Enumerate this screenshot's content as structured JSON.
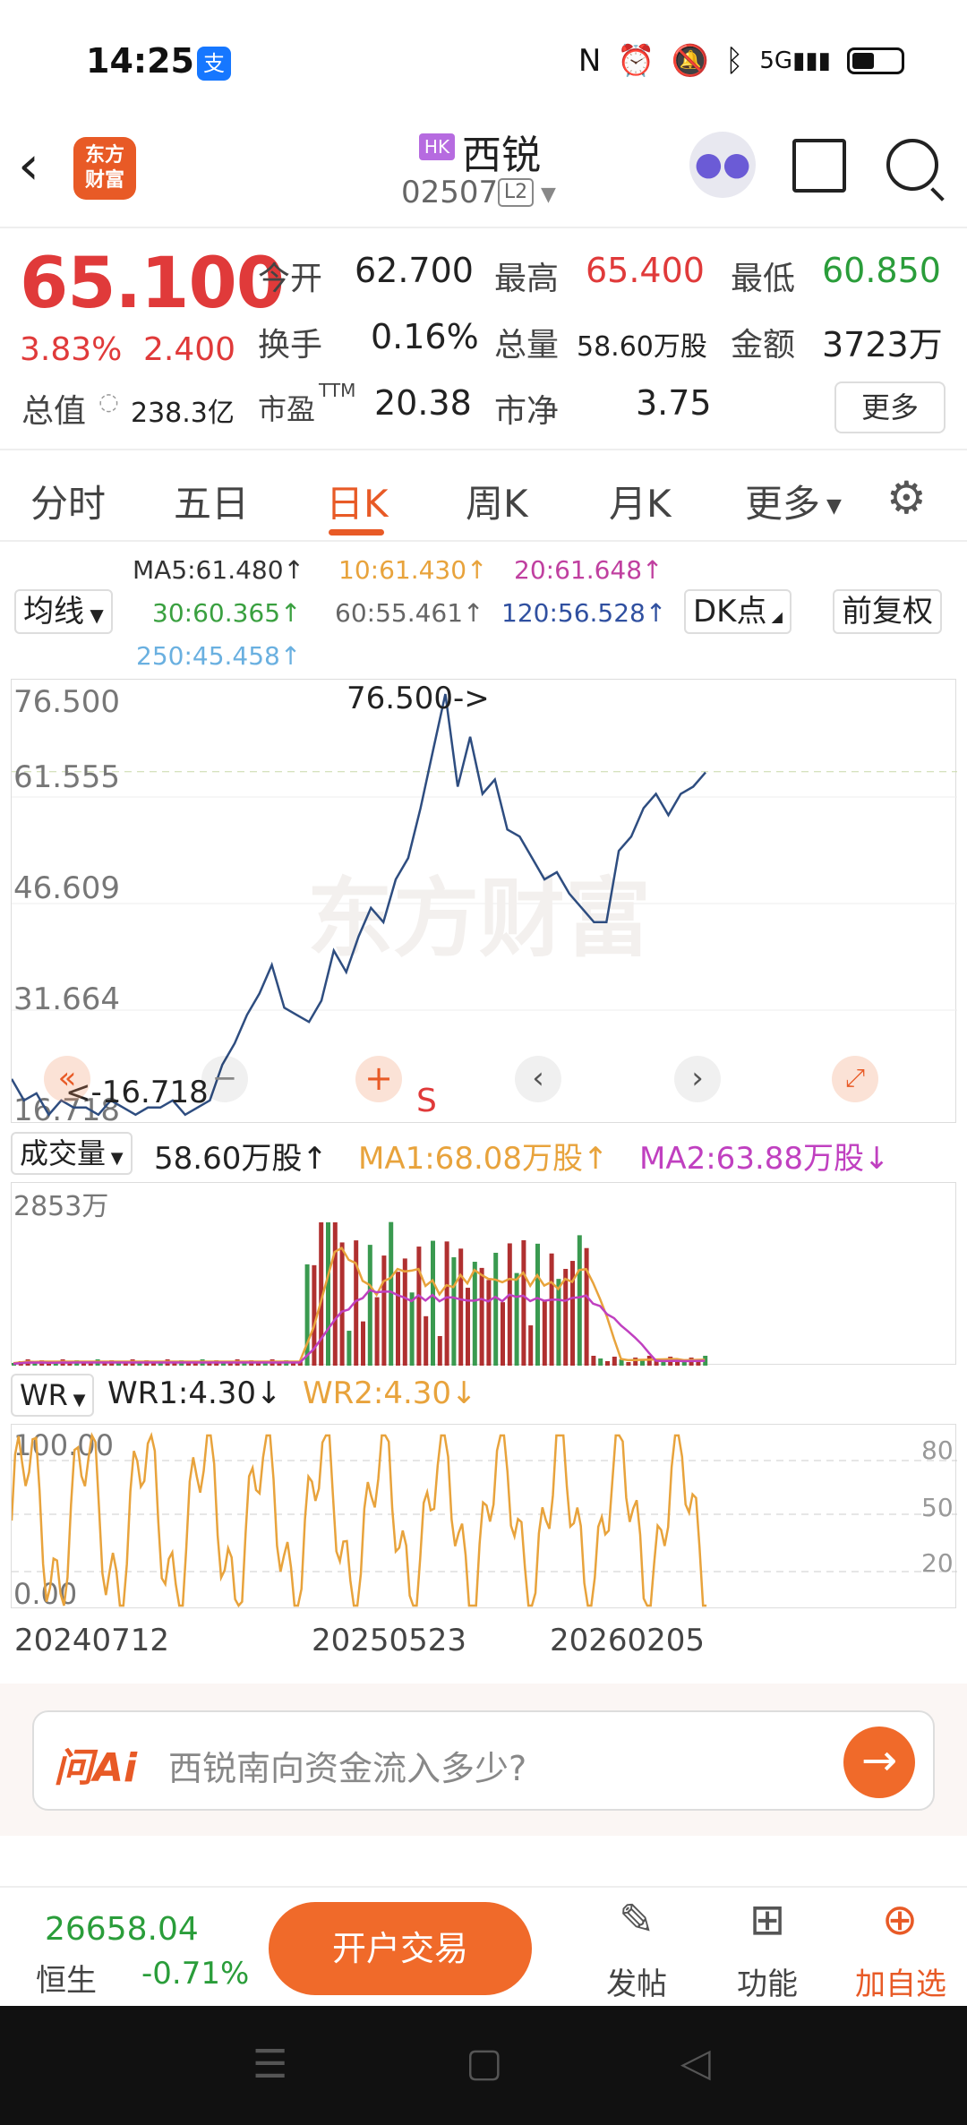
{
  "status": {
    "time": "14:25",
    "alipay": "支",
    "icons": [
      "nfc-icon",
      "alarm-icon",
      "mute-icon",
      "bluetooth-icon",
      "signal-5g-icon"
    ],
    "net": "5G"
  },
  "header": {
    "logo": "东方财富",
    "market": "HK",
    "name": "西锐",
    "code": "02507",
    "level": "L2"
  },
  "quote": {
    "price": "65.100",
    "pct": "3.83%",
    "change": "2.400",
    "open_label": "今开",
    "open": "62.700",
    "high_label": "最高",
    "high": "65.400",
    "low_label": "最低",
    "low": "60.850",
    "turnover_label": "换手",
    "turnover": "0.16%",
    "vol_label": "总量",
    "vol": "58.60万股",
    "amount_label": "金额",
    "amount": "3723万",
    "mcap_label": "总值",
    "mcap": "238.3亿",
    "pe_label": "市盈",
    "pe_sup": "TTM",
    "pe": "20.38",
    "pb_label": "市净",
    "pb": "3.75",
    "more": "更多"
  },
  "tabs": [
    "分时",
    "五日",
    "日K",
    "周K",
    "月K",
    "更多"
  ],
  "active_tab": "日K",
  "ma": {
    "selector": "均线",
    "ma5": "MA5:61.480↑",
    "ma10": "10:61.430↑",
    "ma20": "20:61.648↑",
    "ma30": "30:60.365↑",
    "ma60": "60:55.461↑",
    "ma120": "120:56.528↑",
    "ma250": "250:45.458↑",
    "dk": "DK点",
    "fq": "前复权",
    "colors": {
      "ma5": "#333333",
      "ma10": "#e8a33c",
      "ma20": "#c040a0",
      "ma30": "#3aa040",
      "ma60": "#666666",
      "ma120": "#3050a0",
      "ma250": "#6ab0e0"
    }
  },
  "price_chart": {
    "yticks": [
      "76.500",
      "61.555",
      "46.609",
      "31.664",
      "16.718"
    ],
    "max_marker": "76.500->",
    "min_marker": "<-16.718",
    "signal": "S",
    "watermark": "东方财富"
  },
  "volume": {
    "selector": "成交量",
    "value": "58.60万股↑",
    "ma1": "MA1:68.08万股↑",
    "ma2": "MA2:63.88万股↓",
    "ytick": "2853万"
  },
  "wr": {
    "selector": "WR",
    "wr1": "WR1:4.30↓",
    "wr2": "WR2:4.30↓",
    "yticks_left": [
      "100.00",
      "0.00"
    ],
    "yticks_right": [
      "80",
      "50",
      "20"
    ]
  },
  "dates": [
    "20240712",
    "20250523",
    "20260205"
  ],
  "chart_data": {
    "type": "line",
    "title": "",
    "xlabel": "",
    "ylabel": "",
    "x_ticks": [
      "20240712",
      "20250523",
      "20260205"
    ],
    "ylim": [
      16.718,
      76.5
    ],
    "series": [
      {
        "values": [
          22,
          19,
          20,
          17,
          19,
          18,
          18,
          17,
          19,
          18,
          17,
          18,
          18,
          19,
          17,
          18,
          19,
          24,
          27,
          31,
          34,
          38,
          32,
          31,
          30,
          33,
          40,
          37,
          42,
          46,
          44,
          50,
          53,
          60,
          68,
          76,
          63,
          70,
          62,
          64,
          57,
          56,
          53,
          50,
          51,
          48,
          46,
          44,
          44,
          54,
          56,
          60,
          62,
          59,
          62,
          63,
          65
        ]
      }
    ],
    "volume_ylim_label": "2853万",
    "wr_range": [
      0,
      100
    ]
  },
  "ai": {
    "logo": "问Ai",
    "question": "西锐南向资金流入多少?"
  },
  "bottom": {
    "index_value": "26658.04",
    "index_name": "恒生",
    "index_pct": "-0.71%",
    "trade": "开户交易",
    "post": "发帖",
    "func": "功能",
    "fav": "加自选"
  }
}
